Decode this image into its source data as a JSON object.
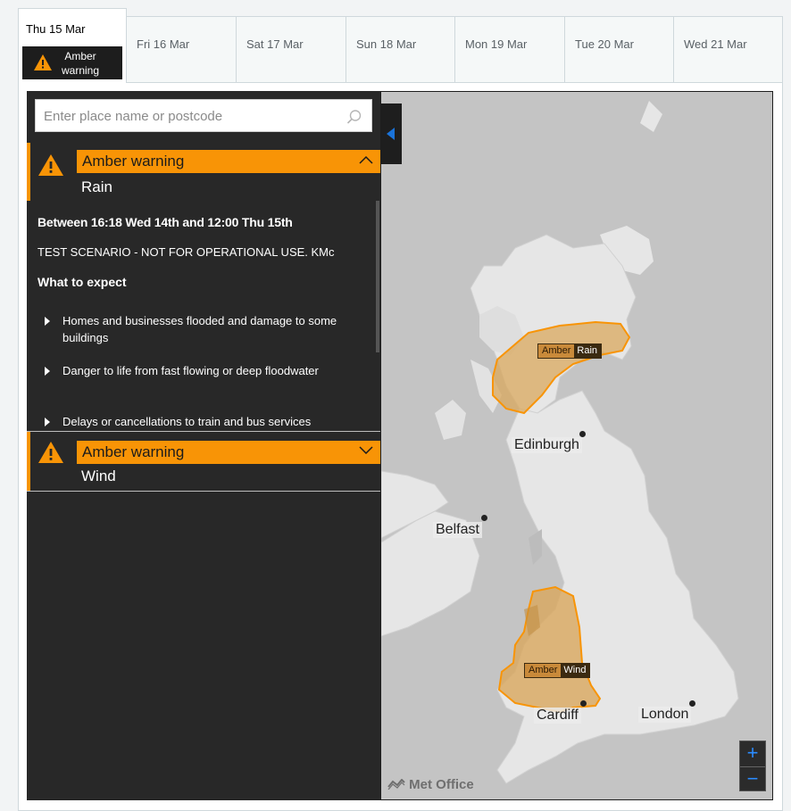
{
  "tabs": [
    {
      "label": "Thu 15 Mar",
      "active": true,
      "badge": "Amber\nwarning"
    },
    {
      "label": "Fri 16 Mar"
    },
    {
      "label": "Sat 17 Mar"
    },
    {
      "label": "Sun 18 Mar"
    },
    {
      "label": "Mon 19 Mar"
    },
    {
      "label": "Tue 20 Mar"
    },
    {
      "label": "Wed 21 Mar"
    }
  ],
  "search": {
    "placeholder": "Enter place name or postcode"
  },
  "warnings": [
    {
      "level": "Amber warning",
      "type": "Rain",
      "expanded": true,
      "dates": "Between 16:18 Wed 14th and 12:00 Thu 15th",
      "scenario": "TEST SCENARIO - NOT FOR OPERATIONAL USE. KMc",
      "what_to_expect": "What to expect",
      "impacts": [
        "Homes and businesses flooded and damage to some buildings",
        "Danger to life from fast flowing or deep floodwater",
        "Delays or cancellations to train and bus services"
      ]
    },
    {
      "level": "Amber warning",
      "type": "Wind",
      "expanded": false
    }
  ],
  "map": {
    "cities": [
      "Edinburgh",
      "Belfast",
      "Cardiff",
      "London"
    ],
    "labels": [
      {
        "level": "Amber",
        "type": "Rain"
      },
      {
        "level": "Amber",
        "type": "Wind"
      }
    ],
    "zoom_in": "+",
    "zoom_out": "−",
    "logo": "Met Office",
    "colors": {
      "sea": "#c4c4c4",
      "land": "#e6e6e6",
      "warning": "#f89406",
      "area_fill": "#d9a85e"
    }
  },
  "colors": {
    "amber": "#f89406",
    "sidebar": "#282828",
    "accent": "#1a73d9"
  }
}
